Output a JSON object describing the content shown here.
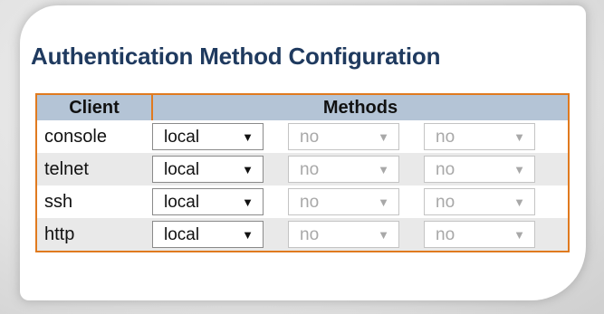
{
  "title": "Authentication Method Configuration",
  "table": {
    "headers": {
      "client": "Client",
      "methods": "Methods"
    },
    "rows": [
      {
        "client": "console",
        "m1": "local",
        "m2": "no",
        "m3": "no"
      },
      {
        "client": "telnet",
        "m1": "local",
        "m2": "no",
        "m3": "no"
      },
      {
        "client": "ssh",
        "m1": "local",
        "m2": "no",
        "m3": "no"
      },
      {
        "client": "http",
        "m1": "local",
        "m2": "no",
        "m3": "no"
      }
    ]
  },
  "icons": {
    "dropdown": "triangle-down-icon",
    "arrow_glyph": "▼"
  },
  "colors": {
    "title": "#1f3a5f",
    "table_border": "#e07a1f",
    "header_bg": "#b4c4d6",
    "row_alt_bg": "#e9e9e9",
    "disabled_text": "#a8a8a8"
  }
}
